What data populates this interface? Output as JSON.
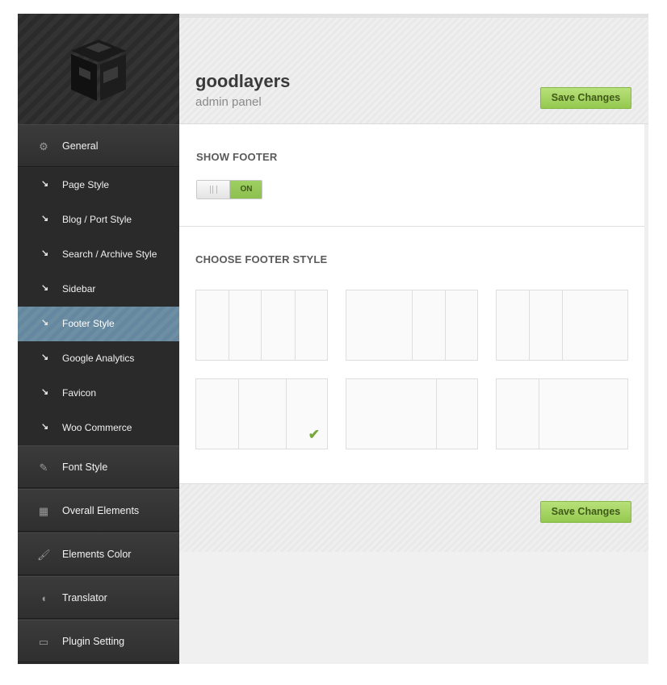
{
  "header": {
    "brand": "goodlayers",
    "subtitle": "admin panel",
    "save_label": "Save Changes"
  },
  "sidebar": {
    "logo_icon": "goodlayers-cube-logo",
    "main_items": [
      {
        "label": "General",
        "icon": "gear-icon"
      },
      {
        "label": "Font Style",
        "icon": "pencil-icon"
      },
      {
        "label": "Overall Elements",
        "icon": "layout-icon"
      },
      {
        "label": "Elements Color",
        "icon": "brush-icon"
      },
      {
        "label": "Translator",
        "icon": "translate-icon"
      },
      {
        "label": "Plugin Setting",
        "icon": "monitor-icon"
      }
    ],
    "sub_items": [
      {
        "label": "Page Style"
      },
      {
        "label": "Blog / Port Style"
      },
      {
        "label": "Search / Archive Style"
      },
      {
        "label": "Sidebar"
      },
      {
        "label": "Footer Style",
        "active": true
      },
      {
        "label": "Google Analytics"
      },
      {
        "label": "Favicon"
      },
      {
        "label": "Woo Commerce"
      }
    ]
  },
  "content": {
    "show_footer": {
      "title": "SHOW FOOTER",
      "toggle_state": "ON"
    },
    "footer_style": {
      "title": "CHOOSE FOOTER STYLE",
      "options": [
        {
          "id": "four-equal",
          "selected": false
        },
        {
          "id": "half-quarter-quarter",
          "selected": false
        },
        {
          "id": "quarter-quarter-half",
          "selected": false
        },
        {
          "id": "three-equal",
          "selected": true
        },
        {
          "id": "two-thirds-one-third",
          "selected": false
        },
        {
          "id": "one-third-two-thirds",
          "selected": false
        }
      ]
    }
  },
  "colors": {
    "sidebar_bg": "#2e2e2e",
    "active_item": "#6b8da3",
    "save_button": "#a4d463",
    "toggle_on": "#96c85a"
  }
}
